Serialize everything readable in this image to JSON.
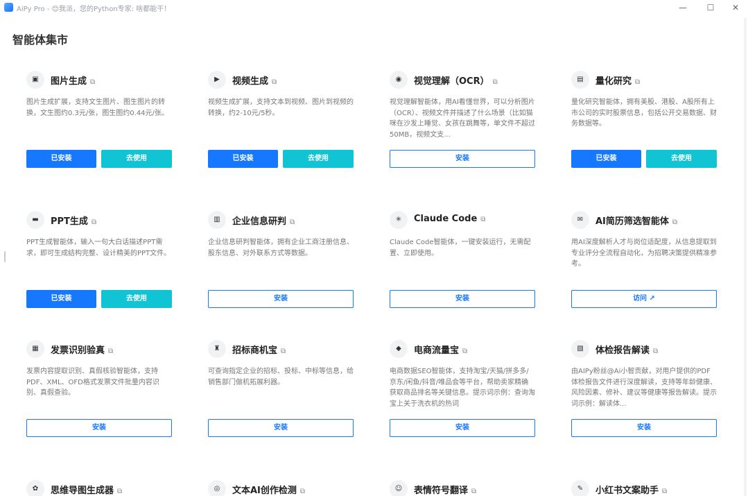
{
  "window": {
    "title": "AiPy Pro - 😊我派，您的Python专家: 啥都能干！",
    "minimize_glyph": "—",
    "maximize_glyph": "☐",
    "close_glyph": "✕"
  },
  "page": {
    "title": "智能体集市"
  },
  "cards": [
    {
      "icon": "image-icon",
      "glyph": "▣",
      "title": "图片生成",
      "desc": "图片生成扩展，支持文生图片、图生图片的转换，文生图约0.3元/张，图生图约0.44元/张。",
      "state": "installed",
      "installed_label": "已安装",
      "use_label": "去使用"
    },
    {
      "icon": "video-icon",
      "glyph": "▶",
      "title": "视频生成",
      "desc": "视频生成扩展，支持文本到视频、图片到视频的转换，约2-10元/5秒。",
      "state": "installed",
      "installed_label": "已安装",
      "use_label": "去使用"
    },
    {
      "icon": "eye-icon",
      "glyph": "◉",
      "title": "视觉理解（OCR）",
      "desc": "视觉理解智能体，用AI看懂世界，可以分析图片（OCR）、视频文件并描述了什么场景（比如猫咪在沙发上睡觉、女孩在跳舞等，单文件不超过50MB，视频文支...",
      "state": "install",
      "install_label": "安装"
    },
    {
      "icon": "chart-icon",
      "glyph": "▤",
      "title": "量化研究",
      "desc": "量化研究智能体，拥有美股、港股、A股所有上市公司的实时股票信息，包括公开交易数据、财务数据等。",
      "state": "installed",
      "installed_label": "已安装",
      "use_label": "去使用"
    },
    {
      "icon": "ppt-icon",
      "glyph": "▬",
      "title": "PPT生成",
      "desc": "PPT生成智能体，输入一句大白话描述PPT需求，即可生成结构完整、设计精美的PPT文件。",
      "state": "installed",
      "installed_label": "已安装",
      "use_label": "去使用"
    },
    {
      "icon": "building-icon",
      "glyph": "▥",
      "title": "企业信息研判",
      "desc": "企业信息研判智能体，拥有企业工商注册信息、股东信息、对外联系方式等数据。",
      "state": "install",
      "install_label": "安装"
    },
    {
      "icon": "claude-icon",
      "glyph": "✳",
      "title": "Claude Code",
      "desc": "Claude Code智能体，一键安装运行，无需配置、立即使用。",
      "state": "install",
      "install_label": "安装"
    },
    {
      "icon": "resume-icon",
      "glyph": "✉",
      "title": "AI简历筛选智能体",
      "desc": "用AI深度解析人才与岗位适配度，从信息提取到专业评分全流程自动化，为招聘决策提供精准参考。",
      "state": "visit",
      "install_label": "访问 ↗"
    },
    {
      "icon": "invoice-icon",
      "glyph": "▦",
      "title": "发票识别验真",
      "desc": "发票内容提取识别、真假核验智能体，支持PDF、XML、OFD格式发票文件批量内容识别、真假查验。",
      "state": "install",
      "install_label": "安装"
    },
    {
      "icon": "bid-icon",
      "glyph": "♜",
      "title": "招标商机宝",
      "desc": "可查询指定企业的招标、投标、中标等信息，给销售部门做机拓展利器。",
      "state": "install",
      "install_label": "安装"
    },
    {
      "icon": "ecommerce-icon",
      "glyph": "◆",
      "title": "电商流量宝",
      "desc": "电商数据SEO智能体，支持淘宝/天猫/拼多多/京东/闲鱼/抖音/唯品会等平台，帮助卖家精确获取商品排名等关键信息。提示词示例：查询淘宝上关于洗衣机的热词",
      "state": "install",
      "install_label": "安装"
    },
    {
      "icon": "report-icon",
      "glyph": "▧",
      "title": "体检报告解读",
      "desc": "由AIPy粉丝@Ai小智贡献，对用户提供的PDF体检报告文件进行深度解读，支持等年龄健康、风险因素、修补、建议等健康等报告解读。提示词示例：解读体...",
      "state": "install",
      "install_label": "安装"
    },
    {
      "icon": "mindmap-icon",
      "glyph": "✿",
      "title": "思维导图生成器",
      "desc": "",
      "state": "none"
    },
    {
      "icon": "detect-icon",
      "glyph": "◎",
      "title": "文本AI创作检测",
      "desc": "",
      "state": "none"
    },
    {
      "icon": "emoji-icon",
      "glyph": "☺",
      "title": "表情符号翻译",
      "desc": "",
      "state": "none"
    },
    {
      "icon": "pen-icon",
      "glyph": "✎",
      "title": "小红书文案助手",
      "desc": "",
      "state": "none"
    }
  ],
  "colors": {
    "primary": "#1677ff",
    "secondary": "#11c4d4"
  }
}
